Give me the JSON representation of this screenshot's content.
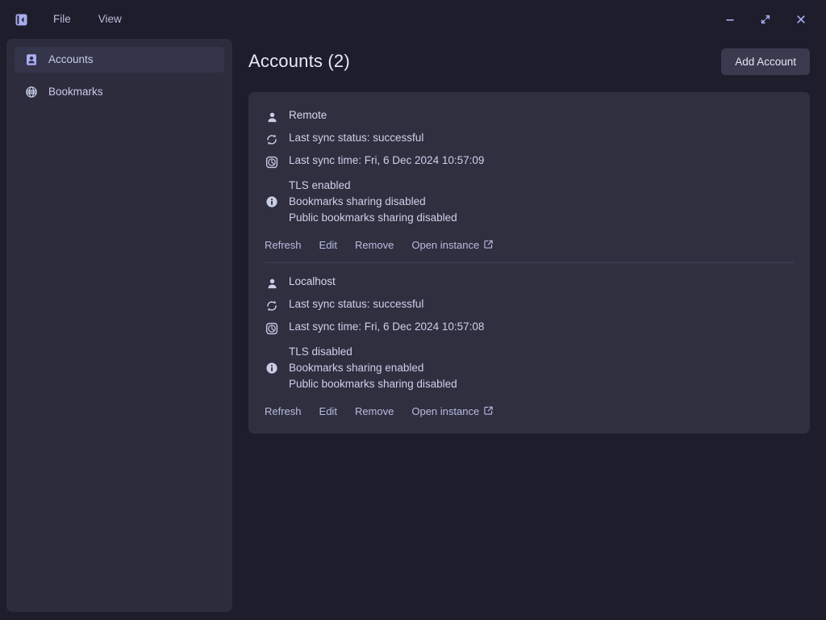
{
  "window": {
    "panel_toggle_icon": "collapse-sidebar-icon",
    "menu": [
      {
        "label": "File"
      },
      {
        "label": "View"
      }
    ],
    "controls": [
      {
        "name": "minimize",
        "icon": "minimize-icon"
      },
      {
        "name": "maximize",
        "icon": "maximize-icon"
      },
      {
        "name": "close",
        "icon": "close-icon"
      }
    ]
  },
  "sidebar": {
    "items": [
      {
        "label": "Accounts",
        "icon": "contact-card-icon",
        "active": true
      },
      {
        "label": "Bookmarks",
        "icon": "globe-icon",
        "active": false
      }
    ]
  },
  "main": {
    "title": "Accounts (2)",
    "add_button": "Add Account",
    "accounts": [
      {
        "name": "Remote",
        "sync_status": "Last sync status: successful",
        "sync_time": "Last sync time: Fri, 6 Dec 2024 10:57:09",
        "info": [
          "TLS enabled",
          "Bookmarks sharing disabled",
          "Public bookmarks sharing disabled"
        ],
        "actions": [
          {
            "label": "Refresh",
            "external": false
          },
          {
            "label": "Edit",
            "external": false
          },
          {
            "label": "Remove",
            "external": false
          },
          {
            "label": "Open instance",
            "external": true
          }
        ]
      },
      {
        "name": "Localhost",
        "sync_status": "Last sync status: successful",
        "sync_time": "Last sync time: Fri, 6 Dec 2024 10:57:08",
        "info": [
          "TLS disabled",
          "Bookmarks sharing enabled",
          "Public bookmarks sharing disabled"
        ],
        "actions": [
          {
            "label": "Refresh",
            "external": false
          },
          {
            "label": "Edit",
            "external": false
          },
          {
            "label": "Remove",
            "external": false
          },
          {
            "label": "Open instance",
            "external": true
          }
        ]
      }
    ]
  },
  "colors": {
    "window_bg": "#1d1d2b",
    "sidebar_bg": "#2c2c3d",
    "card_bg": "#2f2f40",
    "accent": "#a9adf0",
    "text": "#ccd0e8"
  }
}
